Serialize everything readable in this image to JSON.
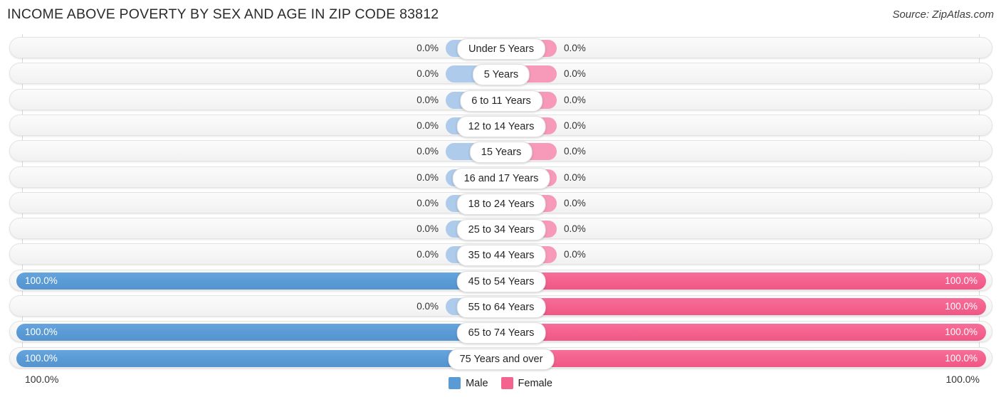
{
  "header": {
    "title": "INCOME ABOVE POVERTY BY SEX AND AGE IN ZIP CODE 83812",
    "source": "Source: ZipAtlas.com"
  },
  "legend": {
    "male_label": "Male",
    "female_label": "Female",
    "male_color": "#5b9bd5",
    "female_color": "#f4628e"
  },
  "axis": {
    "left_label": "100.0%",
    "right_label": "100.0%"
  },
  "chart_data": {
    "type": "bar",
    "subtype": "diverging-bidirectional",
    "title": "INCOME ABOVE POVERTY BY SEX AND AGE IN ZIP CODE 83812",
    "xlabel": "",
    "ylabel": "",
    "xlim": [
      0,
      100
    ],
    "grid": true,
    "legend_position": "bottom-center",
    "categories": [
      "Under 5 Years",
      "5 Years",
      "6 to 11 Years",
      "12 to 14 Years",
      "15 Years",
      "16 and 17 Years",
      "18 to 24 Years",
      "25 to 34 Years",
      "35 to 44 Years",
      "45 to 54 Years",
      "55 to 64 Years",
      "65 to 74 Years",
      "75 Years and over"
    ],
    "series": [
      {
        "name": "Male",
        "direction": "left",
        "color": "#5b9bd5",
        "values": [
          0.0,
          0.0,
          0.0,
          0.0,
          0.0,
          0.0,
          0.0,
          0.0,
          0.0,
          100.0,
          0.0,
          100.0,
          100.0
        ],
        "labels": [
          "0.0%",
          "0.0%",
          "0.0%",
          "0.0%",
          "0.0%",
          "0.0%",
          "0.0%",
          "0.0%",
          "0.0%",
          "100.0%",
          "0.0%",
          "100.0%",
          "100.0%"
        ]
      },
      {
        "name": "Female",
        "direction": "right",
        "color": "#f4628e",
        "values": [
          0.0,
          0.0,
          0.0,
          0.0,
          0.0,
          0.0,
          0.0,
          0.0,
          0.0,
          100.0,
          100.0,
          100.0,
          100.0
        ],
        "labels": [
          "0.0%",
          "0.0%",
          "0.0%",
          "0.0%",
          "0.0%",
          "0.0%",
          "0.0%",
          "0.0%",
          "0.0%",
          "100.0%",
          "100.0%",
          "100.0%",
          "100.0%"
        ]
      }
    ]
  }
}
